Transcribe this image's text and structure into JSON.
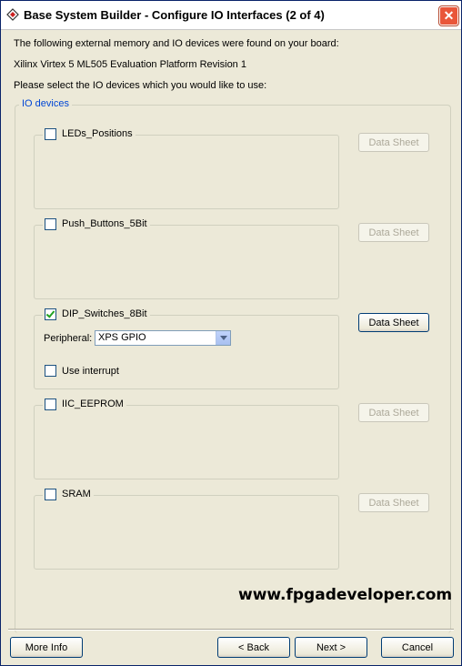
{
  "window": {
    "title": "Base System Builder - Configure IO Interfaces (2 of 4)",
    "close_glyph": "✕"
  },
  "intro": {
    "line1": "The following external memory and IO devices were found on your board:",
    "board": "Xilinx Virtex 5 ML505 Evaluation Platform Revision 1",
    "line3": "Please select the IO devices which you would like to use:"
  },
  "group": {
    "label": "IO devices"
  },
  "devices": [
    {
      "name": "LEDs_Positions",
      "checked": false,
      "datasheet_label": "Data Sheet",
      "datasheet_enabled": false
    },
    {
      "name": "Push_Buttons_5Bit",
      "checked": false,
      "datasheet_label": "Data Sheet",
      "datasheet_enabled": false
    },
    {
      "name": "DIP_Switches_8Bit",
      "checked": true,
      "datasheet_label": "Data Sheet",
      "datasheet_enabled": true,
      "peripheral_label": "Peripheral:",
      "peripheral_value": "XPS GPIO",
      "interrupt_label": "Use interrupt",
      "interrupt_checked": false
    },
    {
      "name": "IIC_EEPROM",
      "checked": false,
      "datasheet_label": "Data Sheet",
      "datasheet_enabled": false
    },
    {
      "name": "SRAM",
      "checked": false,
      "datasheet_label": "Data Sheet",
      "datasheet_enabled": false
    }
  ],
  "watermark": "www.fpgadeveloper.com",
  "buttons": {
    "more_info": "More Info",
    "back": "< Back",
    "next": "Next >",
    "cancel": "Cancel"
  },
  "colors": {
    "group_label": "#0046d5",
    "close": "#e9563a",
    "checkmark": "#21a121"
  }
}
